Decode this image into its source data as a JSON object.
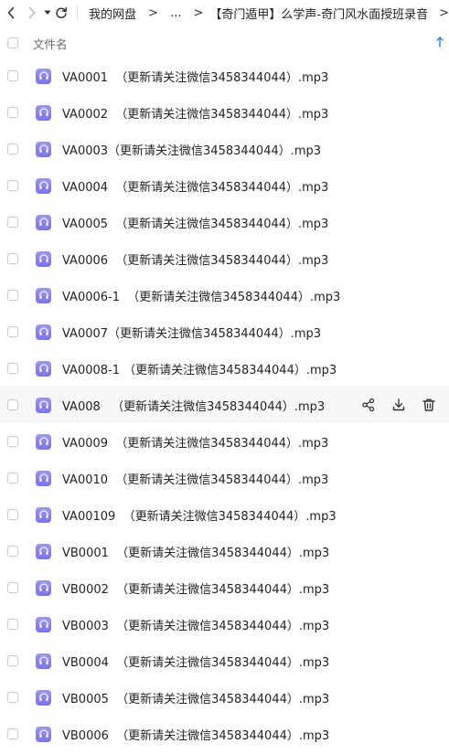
{
  "breadcrumb": {
    "root": "我的网盘",
    "gt1": ">",
    "ellipsis": "...",
    "gt2": ">",
    "current": "【奇门遁甲】么学声-奇门风水面授班录音",
    "gt3": ">"
  },
  "header": {
    "name_col": "文件名"
  },
  "files": [
    {
      "name": "VA0001  （更新请关注微信3458344044）.mp3"
    },
    {
      "name": "VA0002  （更新请关注微信3458344044）.mp3"
    },
    {
      "name": "VA0003（更新请关注微信3458344044）.mp3"
    },
    {
      "name": "VA0004  （更新请关注微信3458344044）.mp3"
    },
    {
      "name": "VA0005  （更新请关注微信3458344044）.mp3"
    },
    {
      "name": "VA0006  （更新请关注微信3458344044）.mp3"
    },
    {
      "name": "VA0006-1  （更新请关注微信3458344044）.mp3"
    },
    {
      "name": "VA0007（更新请关注微信3458344044）.mp3"
    },
    {
      "name": "VA0008-1 （更新请关注微信3458344044）.mp3"
    },
    {
      "name": "VA008   （更新请关注微信3458344044）.mp3"
    },
    {
      "name": "VA0009  （更新请关注微信3458344044）.mp3"
    },
    {
      "name": "VA0010  （更新请关注微信3458344044）.mp3"
    },
    {
      "name": "VA00109  （更新请关注微信3458344044）.mp3"
    },
    {
      "name": "VB0001  （更新请关注微信3458344044）.mp3"
    },
    {
      "name": "VB0002  （更新请关注微信3458344044）.mp3"
    },
    {
      "name": "VB0003  （更新请关注微信3458344044）.mp3"
    },
    {
      "name": "VB0004  （更新请关注微信3458344044）.mp3"
    },
    {
      "name": "VB0005  （更新请关注微信3458344044）.mp3"
    },
    {
      "name": "VB0006  （更新请关注微信3458344044）.mp3"
    }
  ],
  "icons": {
    "file": "headphones-icon",
    "share": "share-icon",
    "download": "download-icon",
    "delete": "trash-icon"
  },
  "colors": {
    "accent": "#2f7cf6",
    "file_icon": "#857bef",
    "hover_row": "#f7f7f7"
  }
}
